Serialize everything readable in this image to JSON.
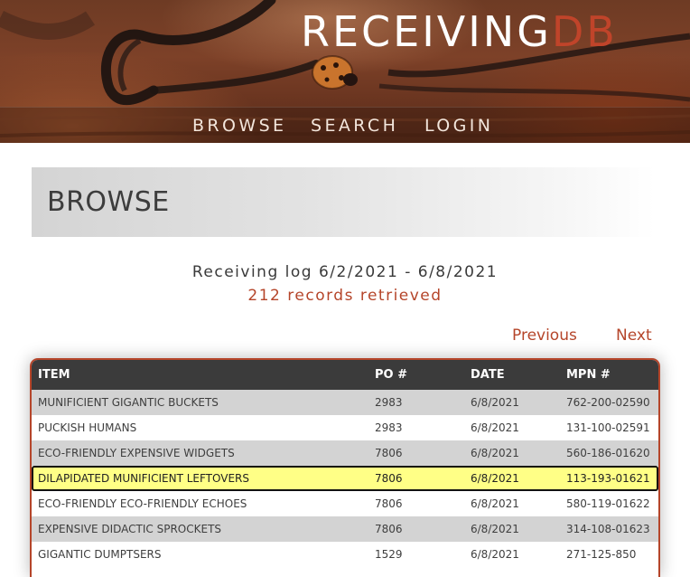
{
  "header": {
    "logo_main": "RECEIVING",
    "logo_accent": "DB",
    "nav": {
      "browse": "BROWSE",
      "search": "SEARCH",
      "login": "LOGIN"
    }
  },
  "page": {
    "heading": "BROWSE",
    "log_range": "Receiving log 6/2/2021 - 6/8/2021",
    "record_count": "212 records retrieved"
  },
  "pager": {
    "previous": "Previous",
    "next": "Next"
  },
  "table": {
    "columns": [
      "ITEM",
      "PO #",
      "DATE",
      "MPN #"
    ],
    "selected_row_index": 3,
    "rows": [
      {
        "item": "MUNIFICIENT GIGANTIC BUCKETS",
        "po": "2983",
        "date": "6/8/2021",
        "mpn": "762-200-02590"
      },
      {
        "item": "PUCKISH HUMANS",
        "po": "2983",
        "date": "6/8/2021",
        "mpn": "131-100-02591"
      },
      {
        "item": "ECO-FRIENDLY EXPENSIVE WIDGETS",
        "po": "7806",
        "date": "6/8/2021",
        "mpn": "560-186-01620"
      },
      {
        "item": "DILAPIDATED MUNIFICIENT LEFTOVERS",
        "po": "7806",
        "date": "6/8/2021",
        "mpn": "113-193-01621"
      },
      {
        "item": "ECO-FRIENDLY ECO-FRIENDLY ECHOES",
        "po": "7806",
        "date": "6/8/2021",
        "mpn": "580-119-01622"
      },
      {
        "item": "EXPENSIVE DIDACTIC SPROCKETS",
        "po": "7806",
        "date": "6/8/2021",
        "mpn": "314-108-01623"
      },
      {
        "item": "GIGANTIC DUMPTSERS",
        "po": "1529",
        "date": "6/8/2021",
        "mpn": "271-125-850"
      }
    ]
  },
  "colors": {
    "accent": "#b5452a",
    "table_header": "#3b3b3b",
    "row_odd": "#d3d3d3",
    "row_even": "#ffffff",
    "row_selected": "#ffff86"
  }
}
